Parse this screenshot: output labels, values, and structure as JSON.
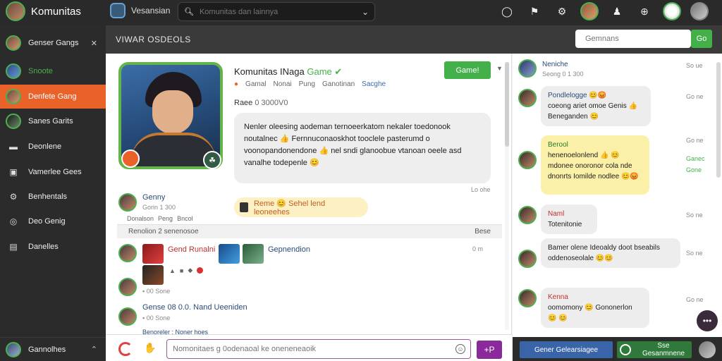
{
  "app": {
    "title": "Komunitas",
    "workspace": "Vesansian"
  },
  "search": {
    "placeholder": "Komunitas dan lainnya"
  },
  "sidebar": {
    "items": [
      {
        "label": "Genser Gangs"
      },
      {
        "label": "Snoote"
      },
      {
        "label": "Denfete Gang"
      },
      {
        "label": "Sanes Garits"
      },
      {
        "label": "Deonlene"
      },
      {
        "label": "Vamerlee Gees"
      },
      {
        "label": "Benhentals"
      },
      {
        "label": "Deo Genig"
      },
      {
        "label": "Danelles"
      }
    ],
    "footer": "Gannolhes"
  },
  "main": {
    "header_title": "VIWAR OSDEOLS",
    "right_search_placeholder": "Gemnans",
    "go_label": "Go"
  },
  "profile": {
    "name": "Komunitas INaga",
    "tag": "Game ✔",
    "meta": [
      "Gamal",
      "Nonai",
      "Pung",
      "Ganotinan",
      "Sacghe"
    ],
    "stat_label": "Raee",
    "stat_value": "0  3000V0",
    "game_button": "Game!",
    "bubble": "Nenler oleesing aodeman ternoeerkatom nekaler toedonook noutalnec 👍 Fernnuconaoskhot tooclele pasterumd o voonopandonendonе 👍 nel sndi glanoobue vtanoan oeele asd vanalhe todepenle 😊",
    "bubble_time": "Lo ohe"
  },
  "feed": {
    "commenter": {
      "name": "Genny",
      "time": "Gorin 1 300",
      "actions": [
        "Donalson",
        "Peng",
        "Bncol"
      ]
    },
    "yellow_pill": "Reme 😊 Sehel lend leoneehes",
    "divider_left": "Renolion 2 senenosoe",
    "divider_right": "Bese",
    "post1": {
      "name": "Gend Runalni",
      "name2": "Gepnendion",
      "time": "0 m"
    },
    "post2": {
      "time": "▪ 00 Sone"
    },
    "post3": {
      "name": "Gense 08 0.0. Nand Ueeniden",
      "time": "▪ 00 Sone"
    },
    "post4": {
      "name": "Benoreler : Noner hoes"
    }
  },
  "composer": {
    "placeholder": "Nomonitaes g 0odenaoal ke oneneneaoik",
    "send_label": "+P"
  },
  "chat": [
    {
      "name": "Neniche",
      "text": "Seong  0 1 300",
      "time": "So ue",
      "style": "plain"
    },
    {
      "name": "Pondlelogge 😊😡",
      "text": "coeong ariet omoe Genis 👍 Beneganden 😊",
      "time": "Go ne",
      "style": "grey"
    },
    {
      "name": "Berool",
      "text": "henenoelonlend 👍 😊 mdonee onoronor cola nde dnonrts Iomilde nodlee 😊😡",
      "time": "Go ne",
      "time2": "Ganec",
      "time3": "Gone",
      "style": "yellow"
    },
    {
      "name": "Naml",
      "text": "Totenitonie",
      "time": "So ne",
      "style": "grey-red"
    },
    {
      "name": "",
      "text": "Bamer olene Ideoaldy doot bseabils oddenoseolale 😊😊",
      "time": "So ne",
      "style": "grey"
    },
    {
      "name": "Kenna",
      "text": "oomomony 😊 Gononerlon 😊 😊",
      "time": "Go ne",
      "style": "grey-red"
    }
  ],
  "footer": {
    "btn1": "Gener Gelearsiagee",
    "btn2": "Sse Gesanmnene"
  }
}
